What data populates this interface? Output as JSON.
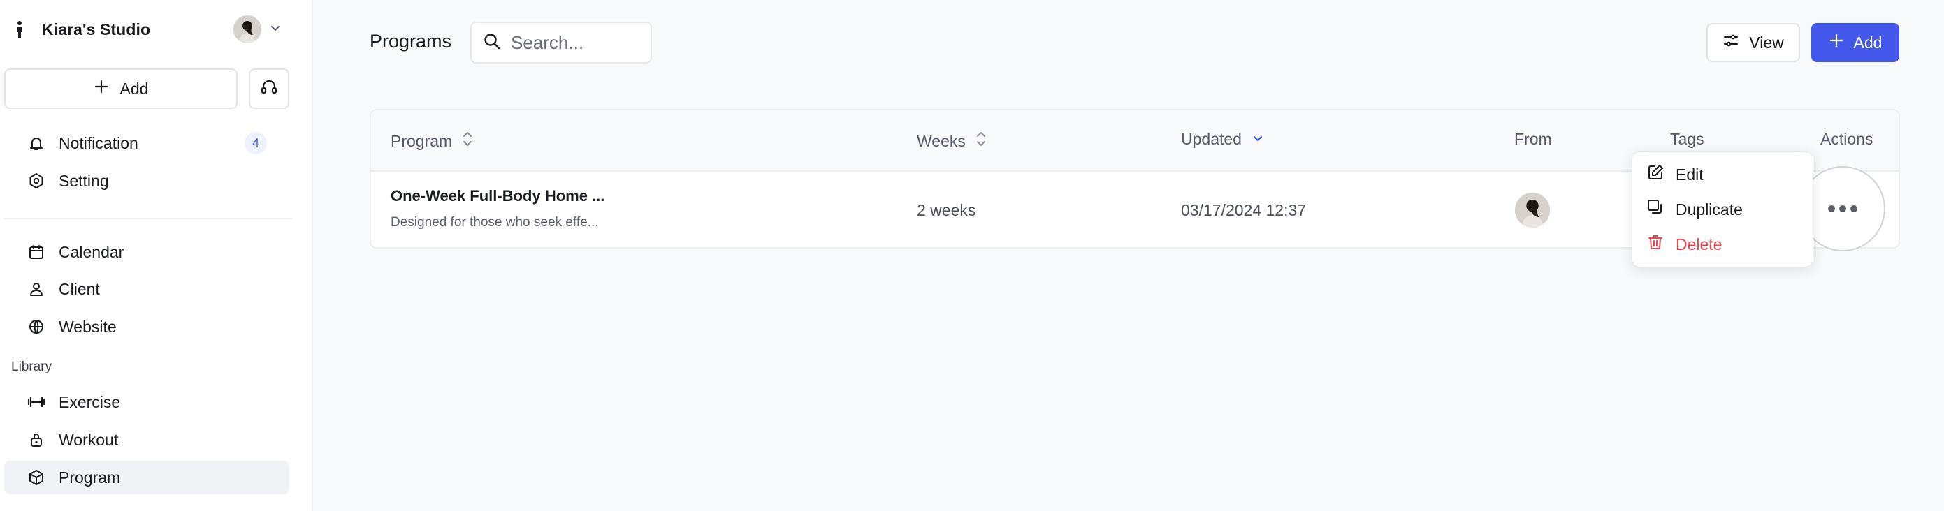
{
  "sidebar": {
    "studio_name": "Kiara's Studio",
    "add_label": "Add",
    "items": [
      {
        "label": "Notification",
        "badge": "4",
        "icon": "bell-icon"
      },
      {
        "label": "Setting",
        "icon": "settings-icon"
      },
      {
        "label": "Calendar",
        "icon": "calendar-icon"
      },
      {
        "label": "Client",
        "icon": "user-icon"
      },
      {
        "label": "Website",
        "icon": "globe-icon"
      },
      {
        "label": "Exercise",
        "icon": "dumbbell-icon"
      },
      {
        "label": "Workout",
        "icon": "workout-icon"
      },
      {
        "label": "Program",
        "icon": "cube-icon"
      }
    ],
    "library_label": "Library"
  },
  "header": {
    "title": "Programs",
    "search_placeholder": "Search...",
    "view_label": "View",
    "add_label": "Add"
  },
  "table": {
    "columns": [
      "Program",
      "Weeks",
      "Updated",
      "From",
      "Tags",
      "Actions"
    ],
    "rows": [
      {
        "name": "One-Week Full-Body Home ...",
        "description": "Designed for those who seek effe...",
        "weeks": "2 weeks",
        "updated": "03/17/2024 12:37"
      }
    ]
  },
  "menu": {
    "edit": "Edit",
    "duplicate": "Duplicate",
    "delete": "Delete"
  },
  "colors": {
    "accent": "#4357ea",
    "danger": "#e5484d",
    "badge_bg": "#eef2ff"
  }
}
